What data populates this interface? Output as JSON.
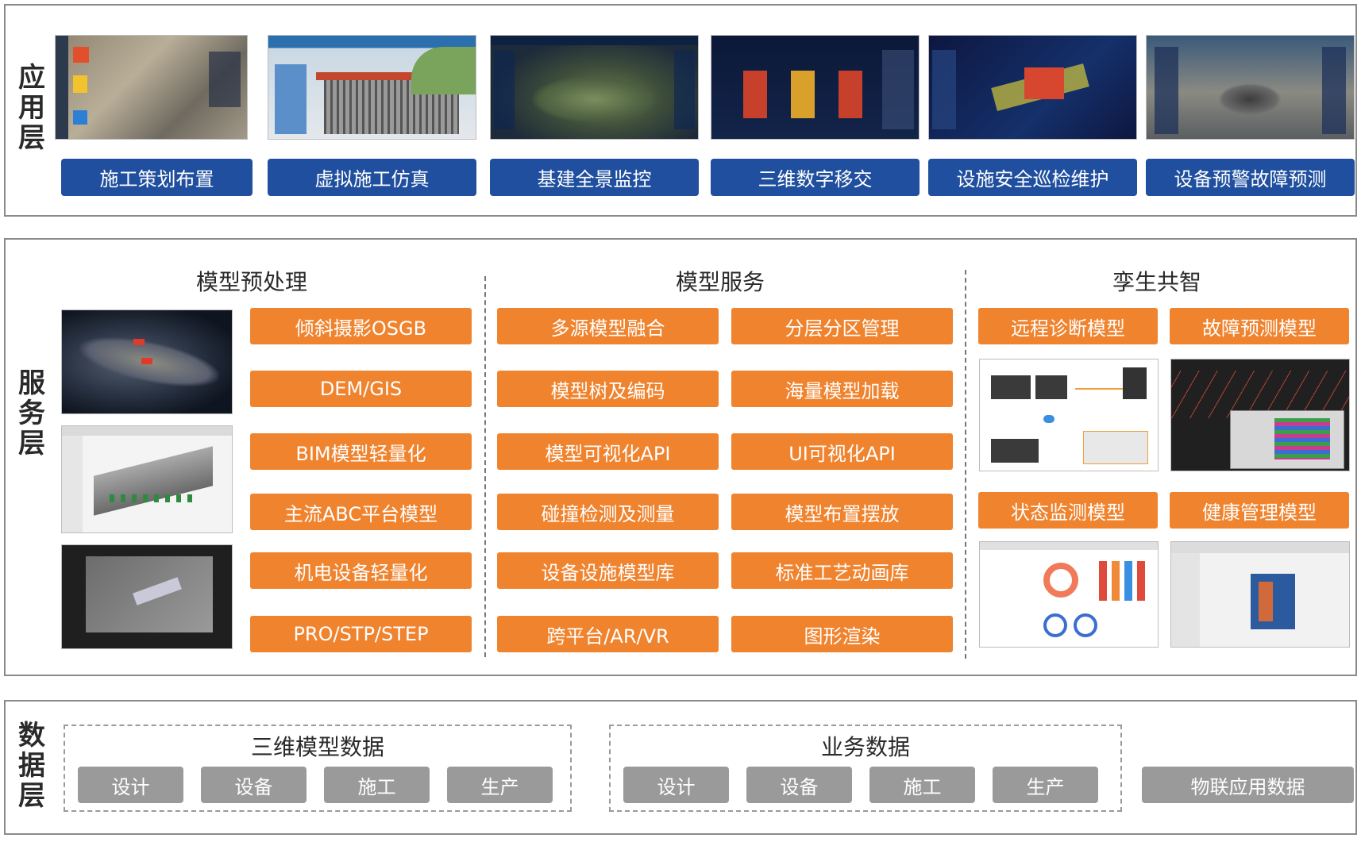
{
  "app_layer": {
    "title": [
      "应",
      "用",
      "层"
    ],
    "items": [
      {
        "label": "施工策划布置",
        "icon": "construction-planning-screenshot"
      },
      {
        "label": "虚拟施工仿真",
        "icon": "virtual-construction-screenshot"
      },
      {
        "label": "基建全景监控",
        "icon": "panorama-monitoring-screenshot"
      },
      {
        "label": "三维数字移交",
        "icon": "3d-digital-handover-screenshot"
      },
      {
        "label": "设施安全巡检维护",
        "icon": "safety-inspection-screenshot"
      },
      {
        "label": "设备预警故障预测",
        "icon": "equipment-warning-screenshot"
      }
    ]
  },
  "service_layer": {
    "title": [
      "服",
      "务",
      "层"
    ],
    "preprocess": {
      "title": "模型预处理",
      "items": [
        "倾斜摄影OSGB",
        "DEM/GIS",
        "BIM模型轻量化",
        "主流ABC平台模型",
        "机电设备轻量化",
        "PRO/STP/STEP"
      ]
    },
    "model_service": {
      "title": "模型服务",
      "left": [
        "多源模型融合",
        "模型树及编码",
        "模型可视化API",
        "碰撞检测及测量",
        "设备设施模型库",
        "跨平台/AR/VR"
      ],
      "right": [
        "分层分区管理",
        "海量模型加载",
        "UI可视化API",
        "模型布置摆放",
        "标准工艺动画库",
        "图形渲染"
      ]
    },
    "twin": {
      "title": "孪生共智",
      "items": [
        "远程诊断模型",
        "故障预测模型",
        "状态监测模型",
        "健康管理模型"
      ]
    }
  },
  "data_layer": {
    "title": [
      "数",
      "据",
      "层"
    ],
    "group1": {
      "title": "三维模型数据",
      "items": [
        "设计",
        "设备",
        "施工",
        "生产"
      ]
    },
    "group2": {
      "title": "业务数据",
      "items": [
        "设计",
        "设备",
        "施工",
        "生产"
      ]
    },
    "iot": "物联应用数据"
  },
  "colors": {
    "blue": "#1f4f9e",
    "orange": "#f0832e",
    "gray": "#9a9a9a",
    "border": "#8a8a8a"
  }
}
